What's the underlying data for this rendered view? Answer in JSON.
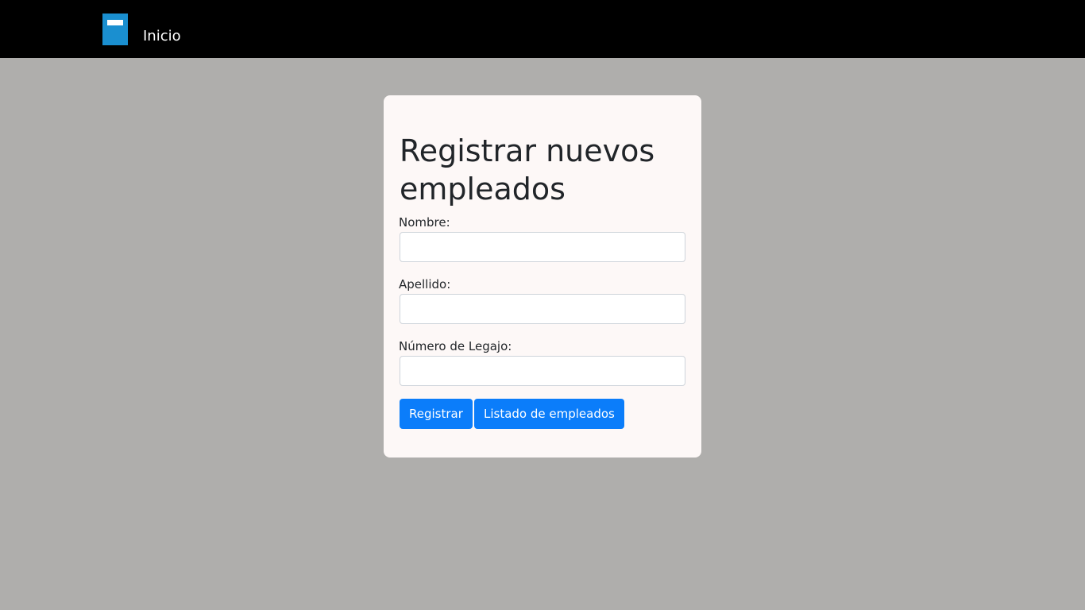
{
  "navbar": {
    "logo_icon": "book-icon",
    "home_link": "Inicio"
  },
  "form": {
    "title": "Registrar nuevos empleados",
    "fields": [
      {
        "label": "Nombre:",
        "value": ""
      },
      {
        "label": "Apellido:",
        "value": ""
      },
      {
        "label": "Número de Legajo:",
        "value": ""
      }
    ],
    "register_button": "Registrar",
    "list_button": "Listado de empleados"
  },
  "colors": {
    "navbar_bg": "#000000",
    "page_bg": "#afaeac",
    "card_bg": "#fdf8f7",
    "button_bg": "#0b7dfa",
    "logo": "#1a8fd0"
  }
}
